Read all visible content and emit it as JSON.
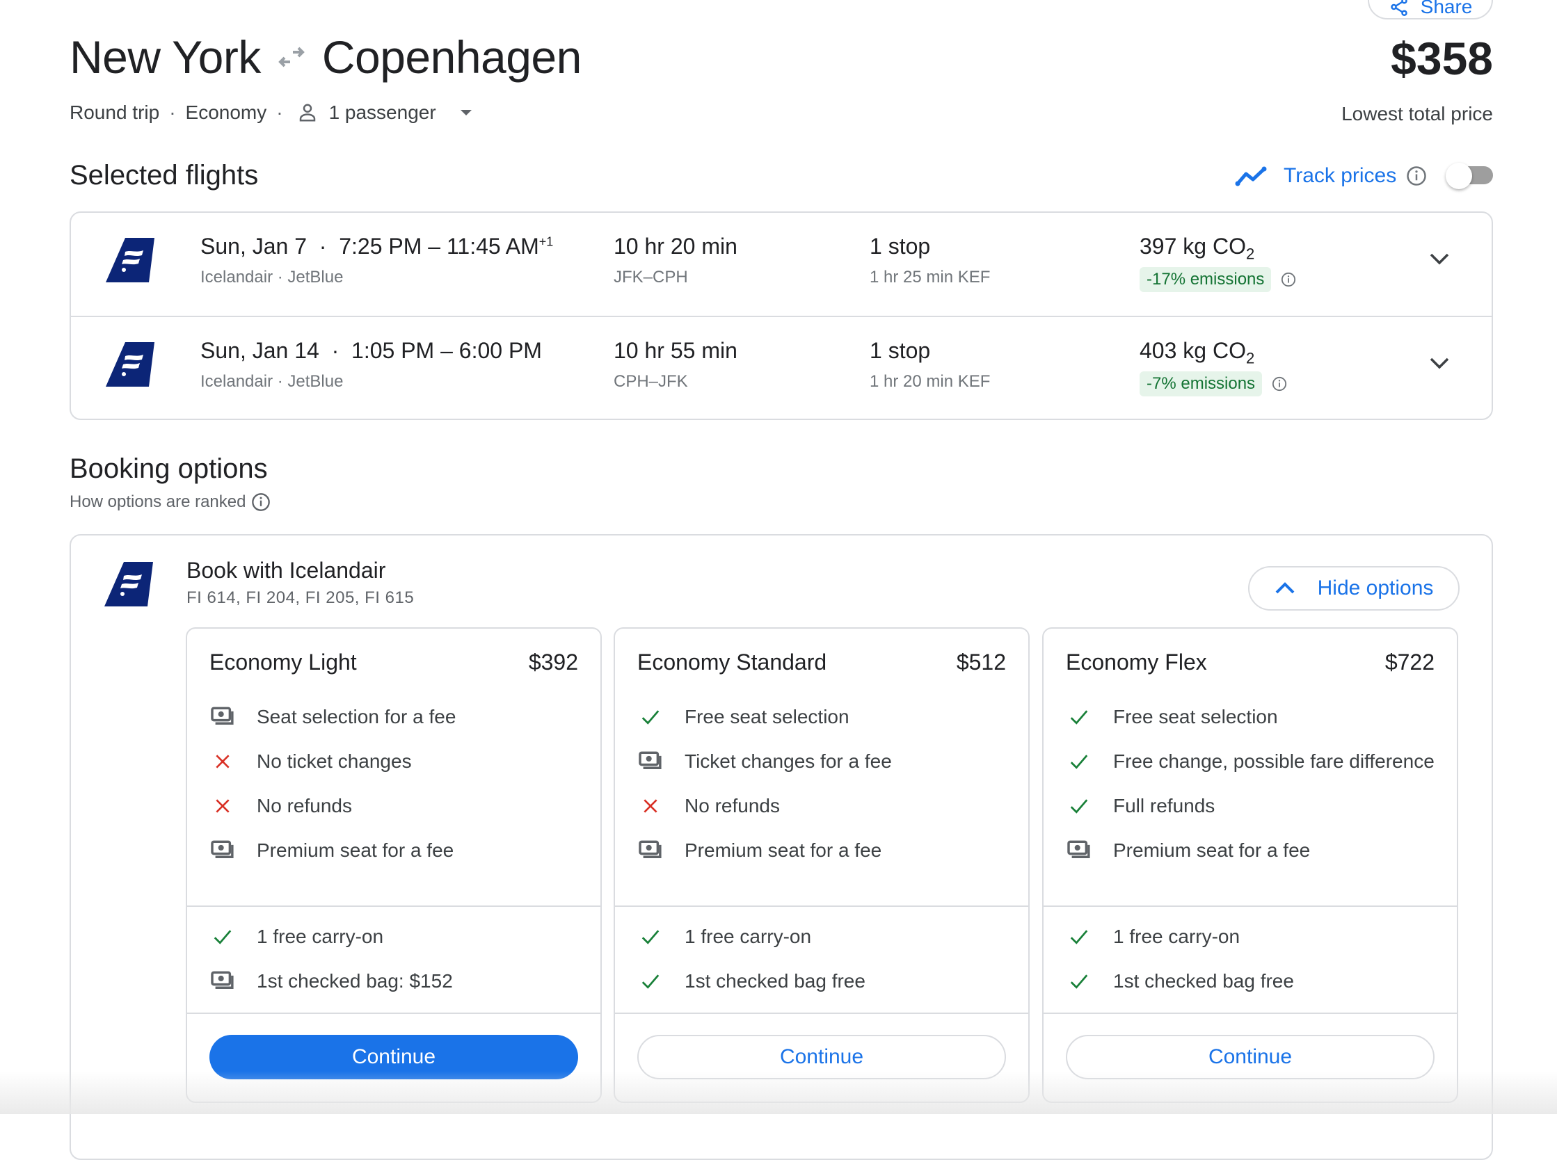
{
  "header": {
    "share_label": "Share",
    "origin": "New York",
    "destination": "Copenhagen",
    "trip_type": "Round trip",
    "cabin": "Economy",
    "passengers": "1 passenger",
    "price": "$358",
    "price_label": "Lowest total price"
  },
  "selected_flights": {
    "title": "Selected flights",
    "track_prices_label": "Track prices",
    "track_prices_enabled": false,
    "flights": [
      {
        "date": "Sun, Jan 7",
        "times": "7:25 PM – 11:45 AM",
        "day_offset": "+1",
        "airlines": "Icelandair · JetBlue",
        "duration": "10 hr 20 min",
        "route": "JFK–CPH",
        "stops": "1 stop",
        "layover": "1 hr 25 min KEF",
        "co2": "397 kg CO",
        "co2_sub": "2",
        "emissions": "-17% emissions"
      },
      {
        "date": "Sun, Jan 14",
        "times": "1:05 PM – 6:00 PM",
        "day_offset": "",
        "airlines": "Icelandair · JetBlue",
        "duration": "10 hr 55 min",
        "route": "CPH–JFK",
        "stops": "1 stop",
        "layover": "1 hr 20 min KEF",
        "co2": "403 kg CO",
        "co2_sub": "2",
        "emissions": "-7% emissions"
      }
    ]
  },
  "booking": {
    "title": "Booking options",
    "ranking_label": "How options are ranked",
    "provider": "Book with Icelandair",
    "flight_numbers": "FI 614, FI 204, FI 205, FI 615",
    "hide_label": "Hide options",
    "fares": [
      {
        "name": "Economy Light",
        "price": "$392",
        "features": [
          {
            "icon": "fee",
            "text": "Seat selection for a fee"
          },
          {
            "icon": "no",
            "text": "No ticket changes"
          },
          {
            "icon": "no",
            "text": "No refunds"
          },
          {
            "icon": "fee",
            "text": "Premium seat for a fee"
          }
        ],
        "bags": [
          {
            "icon": "yes",
            "text": "1 free carry-on"
          },
          {
            "icon": "fee",
            "text": "1st checked bag: $152"
          }
        ],
        "continue_label": "Continue",
        "primary": true
      },
      {
        "name": "Economy Standard",
        "price": "$512",
        "features": [
          {
            "icon": "yes",
            "text": "Free seat selection"
          },
          {
            "icon": "fee",
            "text": "Ticket changes for a fee"
          },
          {
            "icon": "no",
            "text": "No refunds"
          },
          {
            "icon": "fee",
            "text": "Premium seat for a fee"
          }
        ],
        "bags": [
          {
            "icon": "yes",
            "text": "1 free carry-on"
          },
          {
            "icon": "yes",
            "text": "1st checked bag free"
          }
        ],
        "continue_label": "Continue",
        "primary": false
      },
      {
        "name": "Economy Flex",
        "price": "$722",
        "features": [
          {
            "icon": "yes",
            "text": "Free seat selection"
          },
          {
            "icon": "yes",
            "text": "Free change, possible fare difference"
          },
          {
            "icon": "yes",
            "text": "Full refunds"
          },
          {
            "icon": "fee",
            "text": "Premium seat for a fee"
          }
        ],
        "bags": [
          {
            "icon": "yes",
            "text": "1 free carry-on"
          },
          {
            "icon": "yes",
            "text": "1st checked bag free"
          }
        ],
        "continue_label": "Continue",
        "primary": false
      }
    ]
  },
  "colors": {
    "accent": "#1a73e8",
    "airline_brand": "#0c2577",
    "positive": "#188038",
    "negative": "#d93025",
    "emissions_bg": "#e6f4ea",
    "emissions_text": "#137333"
  }
}
